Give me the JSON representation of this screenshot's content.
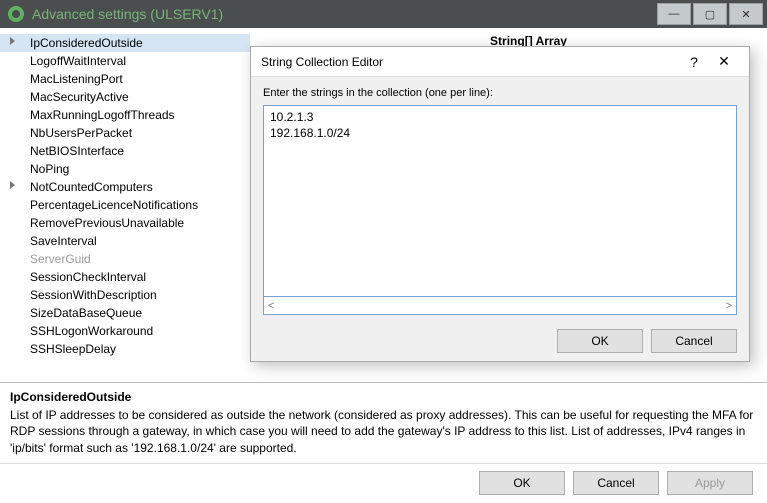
{
  "window": {
    "title": "Advanced settings (ULSERV1)"
  },
  "sidebar": {
    "items": [
      {
        "label": "IpConsideredOutside",
        "selected": true,
        "expander": true
      },
      {
        "label": "LogoffWaitInterval"
      },
      {
        "label": "MacListeningPort"
      },
      {
        "label": "MacSecurityActive"
      },
      {
        "label": "MaxRunningLogoffThreads"
      },
      {
        "label": "NbUsersPerPacket"
      },
      {
        "label": "NetBIOSInterface"
      },
      {
        "label": "NoPing"
      },
      {
        "label": "NotCountedComputers",
        "expander": true
      },
      {
        "label": "PercentageLicenceNotifications"
      },
      {
        "label": "RemovePreviousUnavailable"
      },
      {
        "label": "SaveInterval"
      },
      {
        "label": "ServerGuid",
        "disabled": true
      },
      {
        "label": "SessionCheckInterval"
      },
      {
        "label": "SessionWithDescription"
      },
      {
        "label": "SizeDataBaseQueue"
      },
      {
        "label": "SSHLogonWorkaround"
      },
      {
        "label": "SSHSleepDelay"
      }
    ]
  },
  "main": {
    "heading": "String[] Array"
  },
  "dialog": {
    "title": "String Collection Editor",
    "help": "?",
    "close": "✕",
    "label": "Enter the strings in the collection (one per line):",
    "text": "10.2.1.3\n192.168.1.0/24",
    "ok": "OK",
    "cancel": "Cancel"
  },
  "description": {
    "title": "IpConsideredOutside",
    "body": "List of IP addresses to be considered as outside the network (considered as proxy addresses). This can be useful for requesting the MFA for RDP sessions through a gateway, in which case you will need to add the gateway's IP address to this list. List of addresses, IPv4 ranges in 'ip/bits' format such as '192.168.1.0/24' are supported."
  },
  "buttons": {
    "ok": "OK",
    "cancel": "Cancel",
    "apply": "Apply"
  }
}
